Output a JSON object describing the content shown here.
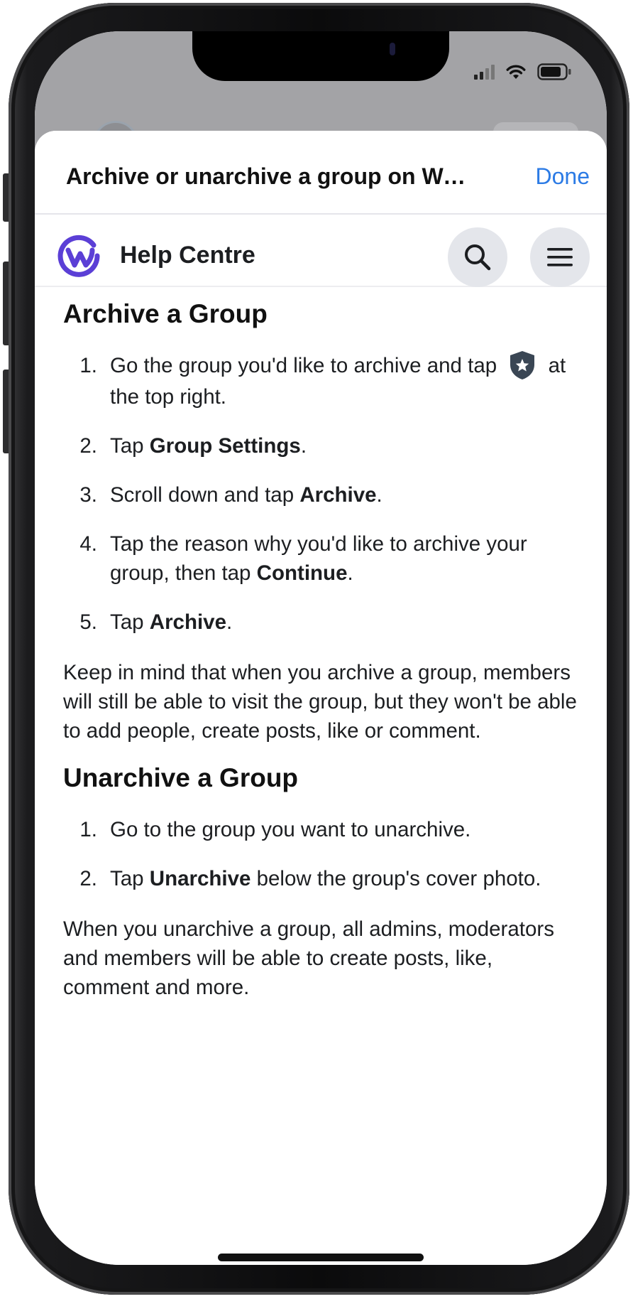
{
  "sheet": {
    "title": "Archive or unarchive a group on Wor...",
    "done_label": "Done"
  },
  "help_bar": {
    "title": "Help Centre",
    "brand_color": "#5b3fd6",
    "search_icon": "search-icon",
    "menu_icon": "hamburger-menu-icon"
  },
  "colors": {
    "link": "#2c7be5",
    "text": "#1c1e21",
    "button_bg": "#e4e6eb"
  },
  "archive_section": {
    "heading": "Archive a Group",
    "steps": [
      {
        "num": "1.",
        "text_a": "Go the group you'd like to archive and tap",
        "text_b": "at the top right.",
        "icon": "admin-shield-star-icon"
      },
      {
        "num": "2.",
        "pre": "Tap ",
        "bold": "Group Settings",
        "post": "."
      },
      {
        "num": "3.",
        "pre": "Scroll down and tap ",
        "bold": "Archive",
        "post": "."
      },
      {
        "num": "4.",
        "pre": "Tap the reason why you'd like to archive your group, then tap ",
        "bold": "Continue",
        "post": "."
      },
      {
        "num": "5.",
        "pre": "Tap ",
        "bold": "Archive",
        "post": "."
      }
    ],
    "note": "Keep in mind that when you archive a group, members will still be able to visit the group, but they won't be able to add people, create posts, like or comment."
  },
  "unarchive_section": {
    "heading": "Unarchive a Group",
    "steps": [
      {
        "num": "1.",
        "text": "Go to the group you want to unarchive."
      },
      {
        "num": "2.",
        "pre": "Tap ",
        "bold": "Unarchive",
        "post": " below the group's cover photo."
      }
    ],
    "note": "When you unarchive a group, all admins, moderators and members will be able to create posts, like, comment and more."
  }
}
